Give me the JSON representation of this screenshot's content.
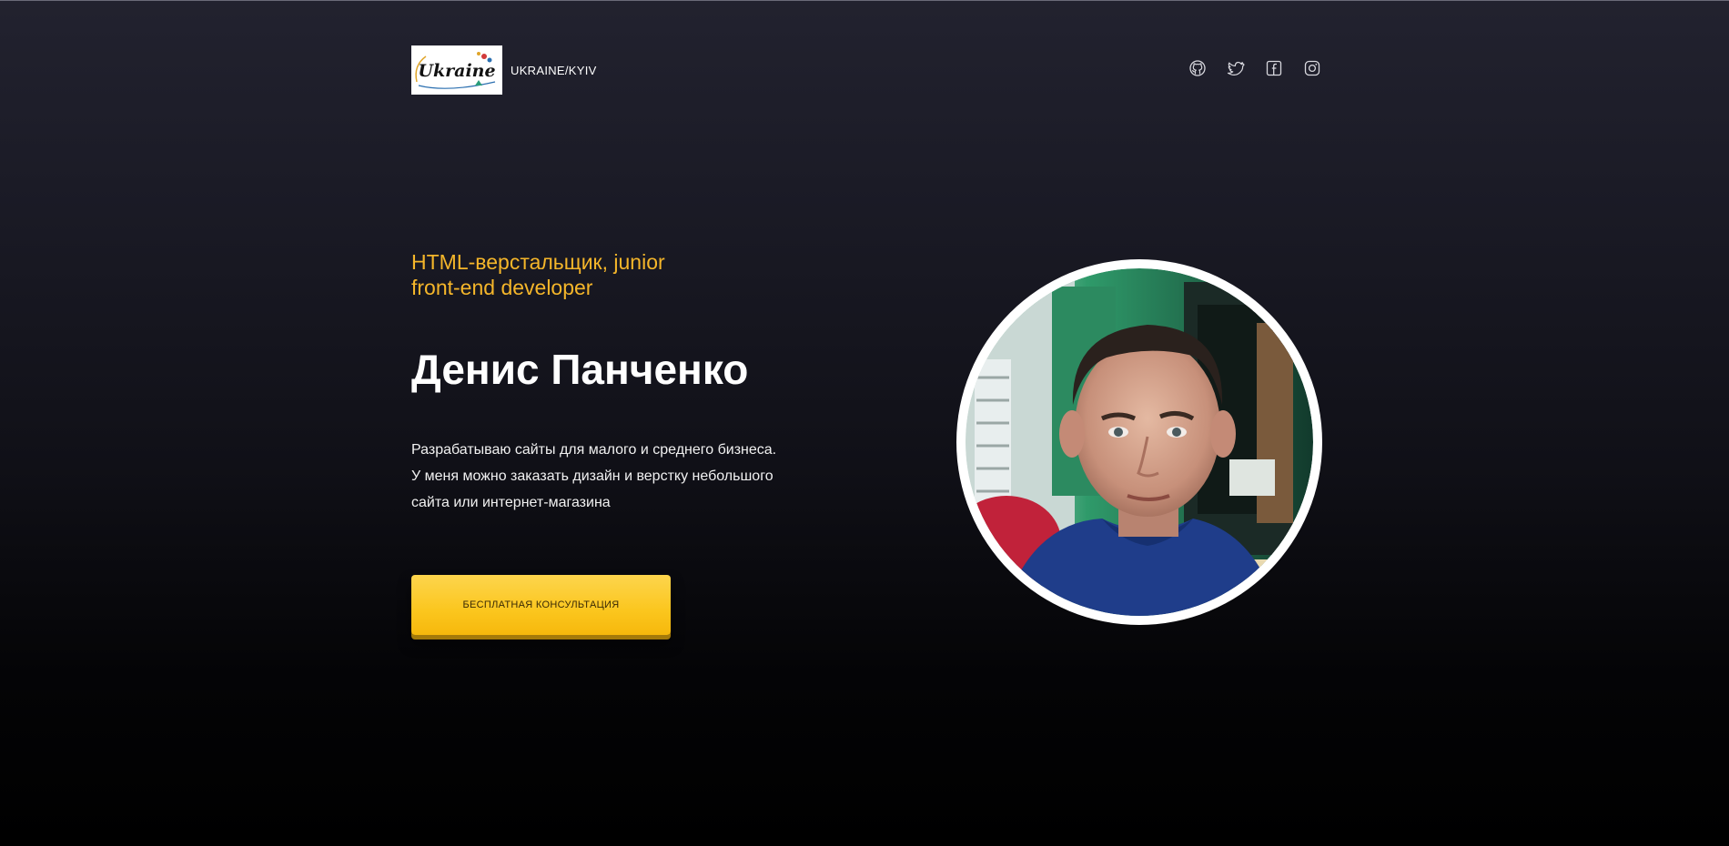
{
  "header": {
    "logo_text": "Ukraine",
    "location": "UKRAINE/KYIV",
    "socials": [
      {
        "name": "github",
        "icon": "github-icon"
      },
      {
        "name": "twitter",
        "icon": "twitter-icon"
      },
      {
        "name": "facebook",
        "icon": "facebook-icon"
      },
      {
        "name": "instagram",
        "icon": "instagram-icon"
      }
    ]
  },
  "hero": {
    "role": "HTML-верстальщик, junior\nfront-end developer",
    "name": "Денис Панченко",
    "bio": "Разрабатываю сайты для малого и среднего бизнеса.\nУ меня можно заказать дизайн и верстку небольшого\nсайта или интернет-магазина",
    "cta_label": "БЕСПЛАТНАЯ КОНСУЛЬТАЦИЯ"
  },
  "colors": {
    "accent": "#f5b62a",
    "button": "#fbc61e",
    "background_top": "#22222f",
    "background_bottom": "#000000"
  }
}
